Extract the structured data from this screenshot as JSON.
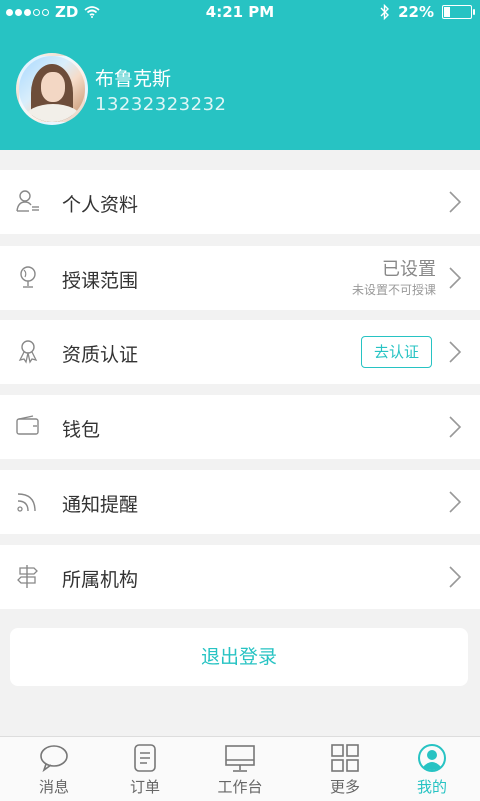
{
  "status_bar": {
    "carrier": "ZD",
    "time": "4:21 PM",
    "battery_text": "22%",
    "battery_level": 0.22
  },
  "profile": {
    "name": "布鲁克斯",
    "phone": "13232323232"
  },
  "menu": [
    {
      "label": "个人资料",
      "icon": "user-profile-icon"
    },
    {
      "label": "授课范围",
      "icon": "globe-icon",
      "value": "已设置",
      "note": "未设置不可授课"
    },
    {
      "label": "资质认证",
      "icon": "award-icon",
      "action": "去认证"
    },
    {
      "label": "钱包",
      "icon": "wallet-icon"
    },
    {
      "label": "通知提醒",
      "icon": "rss-icon"
    },
    {
      "label": "所属机构",
      "icon": "signpost-icon"
    }
  ],
  "logout_label": "退出登录",
  "tabs": [
    {
      "label": "消息",
      "icon": "chat-icon",
      "active": false
    },
    {
      "label": "订单",
      "icon": "document-icon",
      "active": false
    },
    {
      "label": "工作台",
      "icon": "monitor-icon",
      "active": false
    },
    {
      "label": "更多",
      "icon": "grid-icon",
      "active": false
    },
    {
      "label": "我的",
      "icon": "user-circle-icon",
      "active": true
    }
  ],
  "colors": {
    "accent": "#27c3c3",
    "background": "#f2f2f2"
  }
}
